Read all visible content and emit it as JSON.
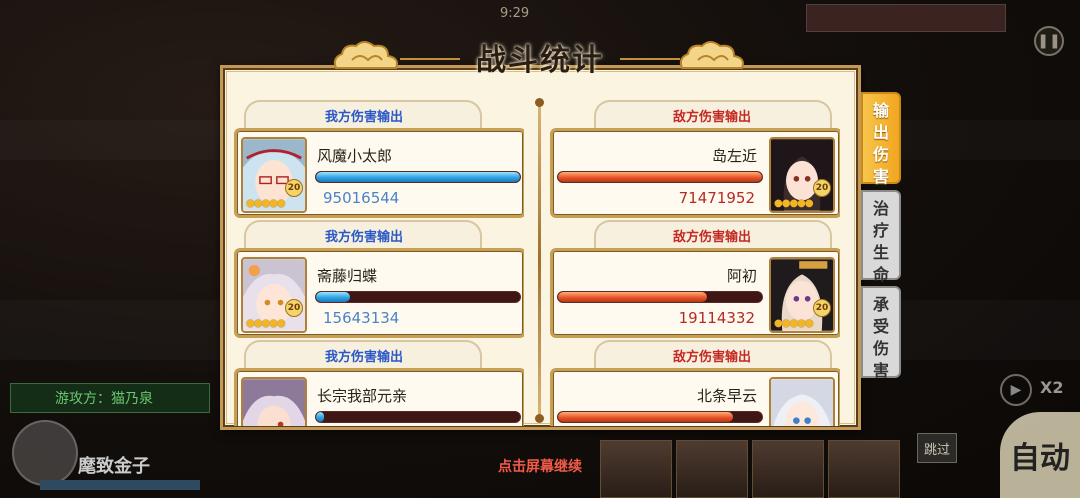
{
  "hud": {
    "top_number": "9:29",
    "opponent_label": "游攻方：猫乃泉",
    "speed_label": "X2",
    "skip_label": "跳过",
    "auto_label": "自动",
    "skill_text": "麾致金子"
  },
  "panel": {
    "title": "战斗统计",
    "ally_header": "我方伤害输出",
    "enemy_header": "敌方伤害输出"
  },
  "ally": [
    {
      "name": "风魔小太郎",
      "value": "95016544",
      "fill": 1.0,
      "level": "20",
      "avatar_icon": "ninja-girl-portrait"
    },
    {
      "name": "斋藤归蝶",
      "value": "15643134",
      "fill": 0.165,
      "level": "20",
      "avatar_icon": "silver-hair-girl-portrait"
    },
    {
      "name": "长宗我部元亲",
      "value": "",
      "fill": 0.04,
      "level": "",
      "avatar_icon": "purple-hair-girl-portrait"
    }
  ],
  "enemy": [
    {
      "name": "岛左近",
      "value": "71471952",
      "fill": 1.0,
      "level": "20",
      "avatar_icon": "dark-hair-girl-portrait"
    },
    {
      "name": "阿初",
      "value": "19114332",
      "fill": 0.73,
      "level": "20",
      "avatar_icon": "black-hair-girl-portrait"
    },
    {
      "name": "北条早云",
      "value": "",
      "fill": 0.86,
      "level": "",
      "avatar_icon": "white-hair-girl-portrait"
    }
  ],
  "tabs": [
    {
      "label": "输出伤害",
      "active": true
    },
    {
      "label": "治疗生命",
      "active": false
    },
    {
      "label": "承受伤害",
      "active": false
    }
  ],
  "footer": {
    "continue_text": "点击屏幕继续"
  },
  "colors": {
    "ally_text": "#2b59c8",
    "enemy_text": "#c42a23",
    "active_tab": "#f2a620",
    "continue": "#f25b4a"
  }
}
